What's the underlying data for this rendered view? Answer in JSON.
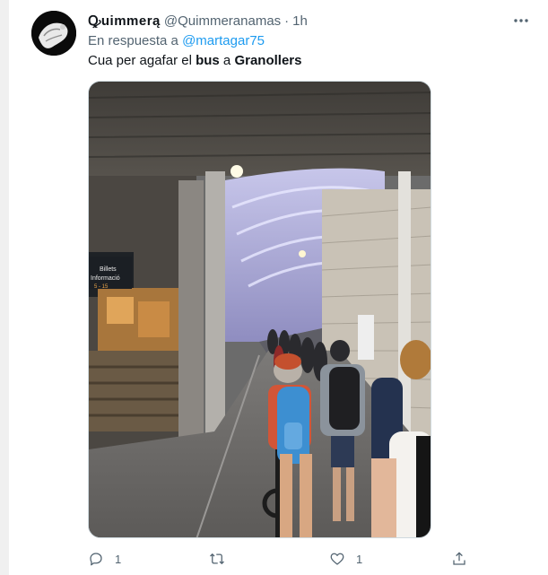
{
  "tweet": {
    "display_name": "Ꝙuimmerą",
    "handle": "@Quimmeranamas",
    "separator": "·",
    "time": "1h",
    "reply_prefix": "En respuesta a",
    "reply_mention": "@martagar75",
    "text_parts": [
      "Cua per agafar el ",
      "bus",
      " a ",
      "Granollers"
    ],
    "media_sign": {
      "line1": "Billets",
      "line2": "Informació",
      "line3": "5 - 15"
    },
    "actions": {
      "reply_count": "1",
      "retweet_count": "",
      "like_count": "1"
    }
  },
  "colors": {
    "accent": "#1d9bf0",
    "secondary_text": "#536471",
    "primary_text": "#0f1419"
  },
  "icons": [
    "more-icon",
    "reply-icon",
    "retweet-icon",
    "like-icon",
    "share-icon"
  ]
}
